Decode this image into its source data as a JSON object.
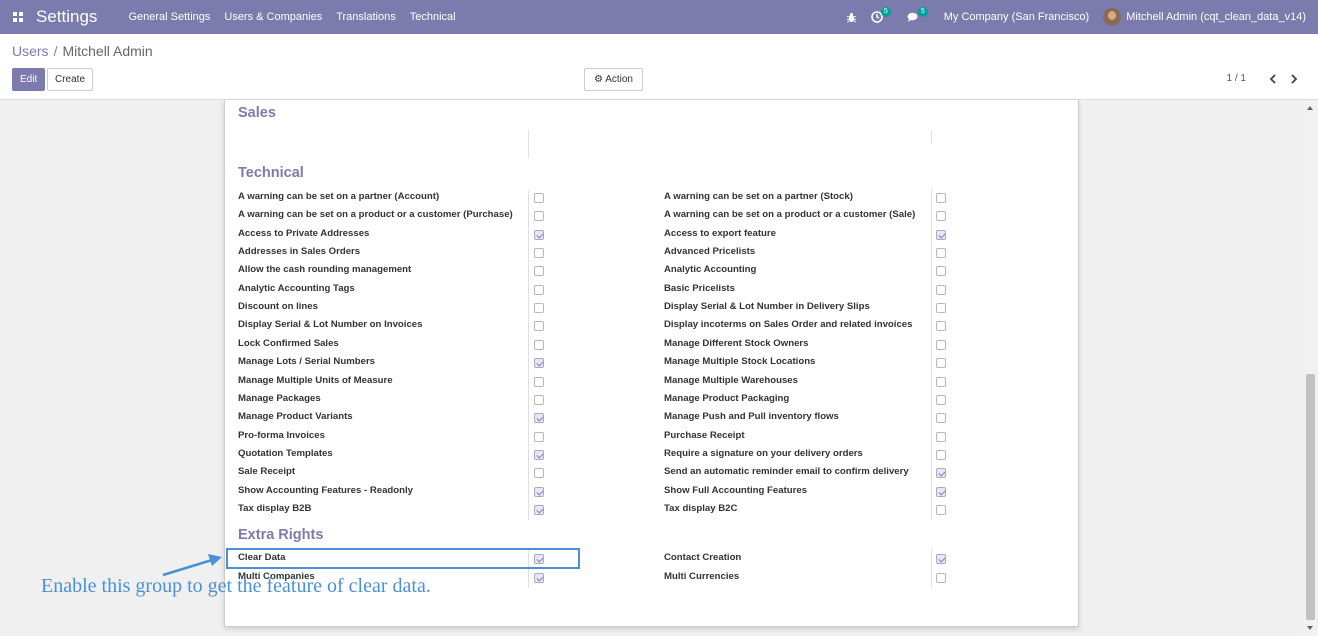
{
  "topbar": {
    "app_title": "Settings",
    "menu": [
      "General Settings",
      "Users & Companies",
      "Translations",
      "Technical"
    ],
    "activity_count": "5",
    "messages_count": "5",
    "company": "My Company (San Francisco)",
    "user": "Mitchell Admin (cqt_clean_data_v14)"
  },
  "breadcrumb": {
    "parent": "Users",
    "separator": "/",
    "current": "Mitchell Admin"
  },
  "buttons": {
    "edit": "Edit",
    "create": "Create",
    "action": "Action"
  },
  "pager": {
    "value": "1 / 1"
  },
  "sections": {
    "sales": "Sales",
    "technical": "Technical",
    "extra_rights": "Extra Rights"
  },
  "technical_rows": [
    {
      "left": "A warning can be set on a partner (Account)",
      "left_checked": false,
      "right": "A warning can be set on a partner (Stock)",
      "right_checked": false
    },
    {
      "left": "A warning can be set on a product or a customer (Purchase)",
      "left_checked": false,
      "right": "A warning can be set on a product or a customer (Sale)",
      "right_checked": false
    },
    {
      "left": "Access to Private Addresses",
      "left_checked": true,
      "right": "Access to export feature",
      "right_checked": true
    },
    {
      "left": "Addresses in Sales Orders",
      "left_checked": false,
      "right": "Advanced Pricelists",
      "right_checked": false
    },
    {
      "left": "Allow the cash rounding management",
      "left_checked": false,
      "right": "Analytic Accounting",
      "right_checked": false
    },
    {
      "left": "Analytic Accounting Tags",
      "left_checked": false,
      "right": "Basic Pricelists",
      "right_checked": false
    },
    {
      "left": "Discount on lines",
      "left_checked": false,
      "right": "Display Serial & Lot Number in Delivery Slips",
      "right_checked": false
    },
    {
      "left": "Display Serial & Lot Number on Invoices",
      "left_checked": false,
      "right": "Display incoterms on Sales Order and related invoices",
      "right_checked": false
    },
    {
      "left": "Lock Confirmed Sales",
      "left_checked": false,
      "right": "Manage Different Stock Owners",
      "right_checked": false
    },
    {
      "left": "Manage Lots / Serial Numbers",
      "left_checked": true,
      "right": "Manage Multiple Stock Locations",
      "right_checked": false
    },
    {
      "left": "Manage Multiple Units of Measure",
      "left_checked": false,
      "right": "Manage Multiple Warehouses",
      "right_checked": false
    },
    {
      "left": "Manage Packages",
      "left_checked": false,
      "right": "Manage Product Packaging",
      "right_checked": false
    },
    {
      "left": "Manage Product Variants",
      "left_checked": true,
      "right": "Manage Push and Pull inventory flows",
      "right_checked": false
    },
    {
      "left": "Pro-forma Invoices",
      "left_checked": false,
      "right": "Purchase Receipt",
      "right_checked": false
    },
    {
      "left": "Quotation Templates",
      "left_checked": true,
      "right": "Require a signature on your delivery orders",
      "right_checked": false
    },
    {
      "left": "Sale Receipt",
      "left_checked": false,
      "right": "Send an automatic reminder email to confirm delivery",
      "right_checked": true
    },
    {
      "left": "Show Accounting Features - Readonly",
      "left_checked": true,
      "right": "Show Full Accounting Features",
      "right_checked": true
    },
    {
      "left": "Tax display B2B",
      "left_checked": true,
      "right": "Tax display B2C",
      "right_checked": false
    }
  ],
  "extra_rows": [
    {
      "left": "Clear Data",
      "left_checked": true,
      "right": "Contact Creation",
      "right_checked": true
    },
    {
      "left": "Multi Companies",
      "left_checked": true,
      "right": "Multi Currencies",
      "right_checked": false
    }
  ],
  "annotation": {
    "text": "Enable this group to get the feature of clear data.",
    "color": "#4a90d9"
  },
  "colors": {
    "brand": "#7c7bad",
    "badge": "#00a09d"
  }
}
